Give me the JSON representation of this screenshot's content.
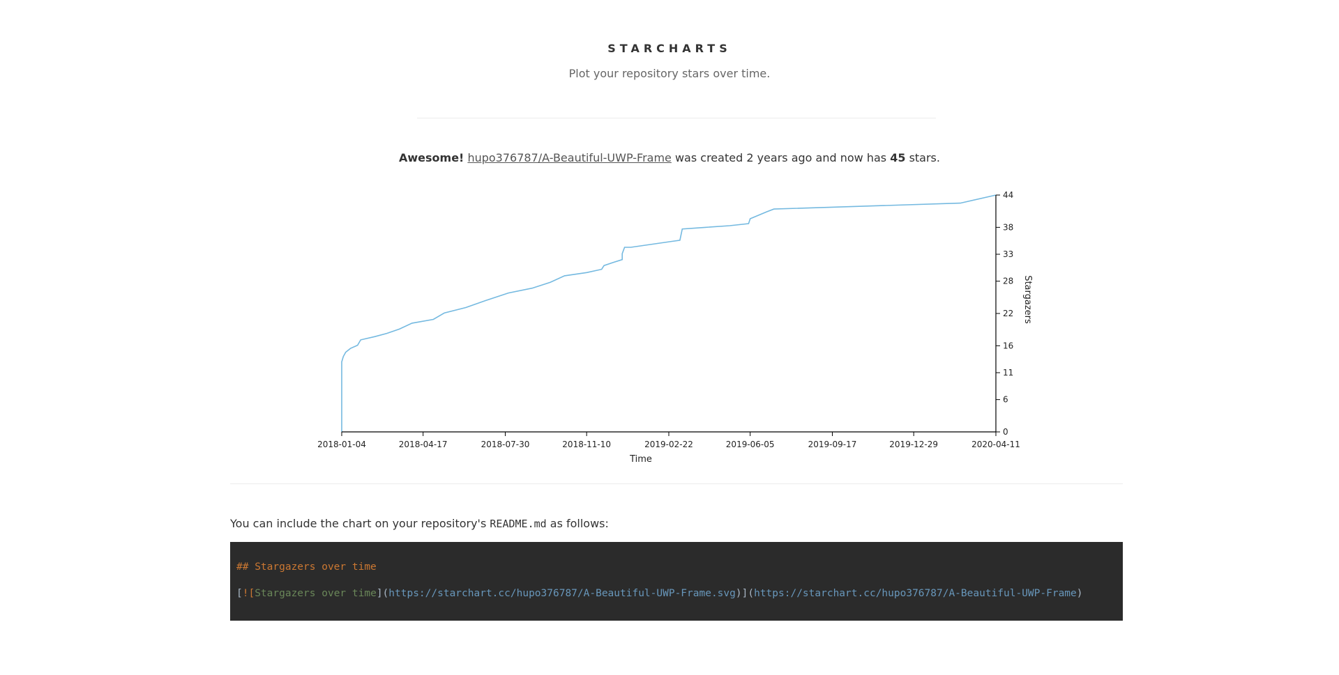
{
  "header": {
    "title": "STARCHARTS",
    "subtitle": "Plot your repository stars over time."
  },
  "summary": {
    "prefix": "Awesome!",
    "repo": "hupo376787/A-Beautiful-UWP-Frame",
    "middle": "was created 2 years ago and now has",
    "stars": "45",
    "suffix": "stars."
  },
  "chart_data": {
    "type": "line",
    "xlabel": "Time",
    "ylabel": "Stargazers",
    "x_ticks": [
      "2018-01-04",
      "2018-04-17",
      "2018-07-30",
      "2018-11-10",
      "2019-02-22",
      "2019-06-05",
      "2019-09-17",
      "2019-12-29",
      "2020-04-11"
    ],
    "y_ticks": [
      "0",
      "6",
      "11",
      "16",
      "22",
      "28",
      "33",
      "38",
      "44"
    ],
    "xlim": [
      "2018-01-04",
      "2020-04-11"
    ],
    "ylim": [
      0,
      44
    ],
    "y_axis_position": "right",
    "line_color": "#74b9e0",
    "series": [
      {
        "x": [
          "2018-01-04",
          "2018-01-04",
          "2018-01-06",
          "2018-01-09",
          "2018-01-15",
          "2018-01-24",
          "2018-01-28",
          "2018-02-15",
          "2018-03-02",
          "2018-03-18",
          "2018-04-03",
          "2018-04-30",
          "2018-05-14",
          "2018-06-10",
          "2018-07-05",
          "2018-08-03",
          "2018-09-02",
          "2018-09-25",
          "2018-10-13",
          "2018-11-10",
          "2018-11-29",
          "2018-12-02",
          "2018-12-14",
          "2018-12-25",
          "2018-12-25",
          "2018-12-28",
          "2019-01-05",
          "2019-02-26",
          "2019-03-08",
          "2019-03-11",
          "2019-04-09",
          "2019-05-10",
          "2019-06-03",
          "2019-06-05",
          "2019-06-26",
          "2019-07-05",
          "2020-02-26",
          "2020-04-11"
        ],
        "y": [
          0,
          13.0,
          14.0,
          14.8,
          15.5,
          16.1,
          17.1,
          17.7,
          18.3,
          19.1,
          20.2,
          20.9,
          22.1,
          23.1,
          24.4,
          25.8,
          26.7,
          27.8,
          29.0,
          29.6,
          30.2,
          30.9,
          31.5,
          32.0,
          33.1,
          34.3,
          34.3,
          35.4,
          35.6,
          37.7,
          38.0,
          38.3,
          38.7,
          39.6,
          40.9,
          41.4,
          42.5,
          44.0
        ]
      }
    ]
  },
  "readme": {
    "text_before": "You can include the chart on your repository's",
    "filename": "README.md",
    "text_after": "as follows:",
    "code_heading": "## Stargazers over time",
    "code_open": "[",
    "code_bang_bracket": "![",
    "code_alt": "Stargazers over time",
    "code_close_alt": "](",
    "code_img_url": "https://starchart.cc/hupo376787/A-Beautiful-UWP-Frame.svg",
    "code_mid": ")](",
    "code_repo_url": "https://starchart.cc/hupo376787/A-Beautiful-UWP-Frame",
    "code_end": ")"
  }
}
